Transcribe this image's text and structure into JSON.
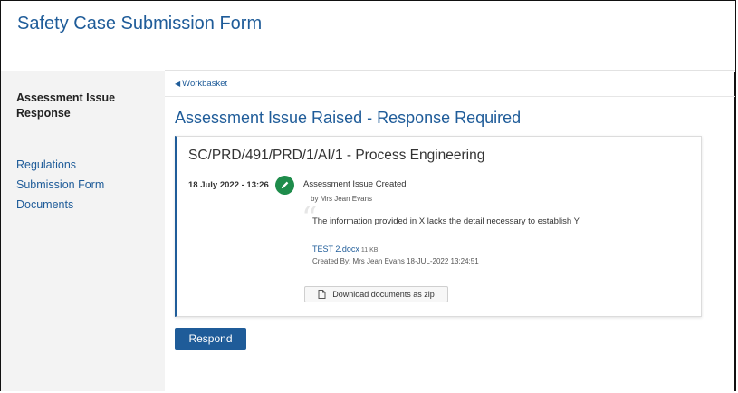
{
  "app": {
    "title": "Safety Case Submission Form"
  },
  "sidebar": {
    "heading": "Assessment Issue Response",
    "links": [
      {
        "label": "Regulations"
      },
      {
        "label": "Submission Form"
      },
      {
        "label": "Documents"
      }
    ]
  },
  "breadcrumb": {
    "back_label": "Workbasket"
  },
  "page": {
    "title": "Assessment Issue Raised - Response Required"
  },
  "issue": {
    "reference": "SC/PRD/491/PRD/1/AI/1 - Process Engineering",
    "event": {
      "datetime": "18 July 2022 - 13:26",
      "icon": "pencil-icon",
      "icon_color": "#1e8c4b",
      "title": "Assessment Issue Created",
      "by": "by Mrs Jean Evans",
      "comment": "The information provided in X lacks the detail necessary to establish Y"
    },
    "attachment": {
      "file_name": "TEST 2.docx",
      "file_size": "11 KB",
      "created_by": "Created By: Mrs Jean Evans 18-JUL-2022 13:24:51"
    },
    "download_zip_label": "Download documents as zip"
  },
  "actions": {
    "respond_label": "Respond"
  },
  "colors": {
    "accent": "#1f5c99",
    "sidebar_bg": "#f3f3f3"
  }
}
